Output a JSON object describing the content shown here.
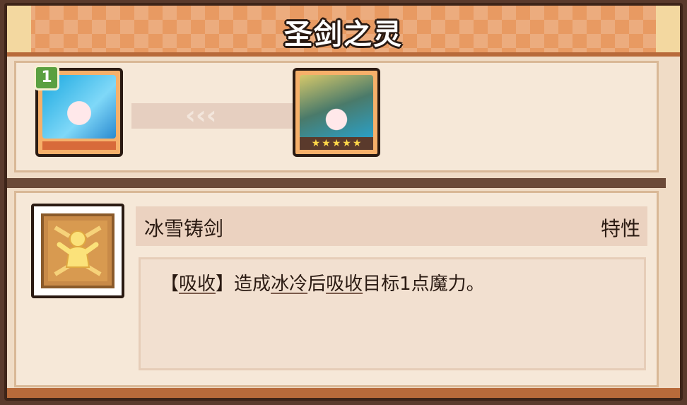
{
  "header": {
    "title": "圣剑之灵"
  },
  "evolution": {
    "from": {
      "name": "blue-haired-hero-portrait",
      "level_badge": "1"
    },
    "to": {
      "name": "armored-hero-portrait",
      "stars": 5,
      "star_glyph": "★"
    },
    "arrows": "‹‹‹"
  },
  "skill": {
    "icon": "golden-figure-icon",
    "name": "冰雪铸剑",
    "type": "特性",
    "description": {
      "bracket_open": "【",
      "keyword": "吸收",
      "bracket_close": "】",
      "part1": "造成",
      "kw_cold": "冰冷",
      "part2": "后",
      "kw_absorb": "吸收",
      "part3": "目标1点魔力。"
    }
  },
  "colors": {
    "header": "#e89a62",
    "panel": "#f6e8d8",
    "frame_dark": "#2a1a12",
    "badge_green": "#5aa040"
  }
}
